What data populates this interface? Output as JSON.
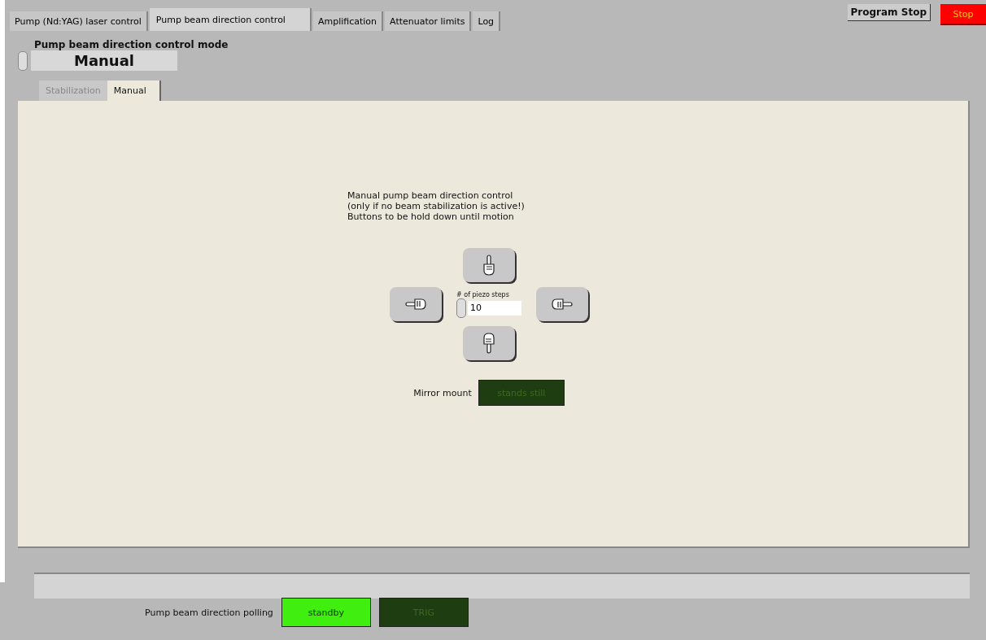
{
  "tabs": [
    {
      "label": "Pump (Nd:YAG) laser control",
      "selected": false
    },
    {
      "label": "Pump beam direction control",
      "selected": true
    },
    {
      "label": "Amplification",
      "selected": false
    },
    {
      "label": "Attenuator limits",
      "selected": false
    },
    {
      "label": "Log",
      "selected": false
    }
  ],
  "program_stop": {
    "label": "Program Stop",
    "button": "Stop"
  },
  "mode": {
    "label": "Pump beam direction control mode",
    "value": "Manual"
  },
  "subtabs": [
    {
      "label": "Stabilization",
      "selected": false
    },
    {
      "label": "Manual",
      "selected": true
    }
  ],
  "manual": {
    "description": [
      "Manual pump beam direction control",
      "(only if no beam stabilization  is active!)",
      "Buttons to be hold down until motion"
    ],
    "steps": {
      "label": "# of piezo steps",
      "value": "10"
    },
    "mirror": {
      "label": "Mirror mount",
      "text": "stands still",
      "on": false
    }
  },
  "polling": {
    "label": "Pump beam direction polling",
    "leds": [
      {
        "text": "standby",
        "on": true
      },
      {
        "text": "TRIG",
        "on": false
      }
    ]
  }
}
